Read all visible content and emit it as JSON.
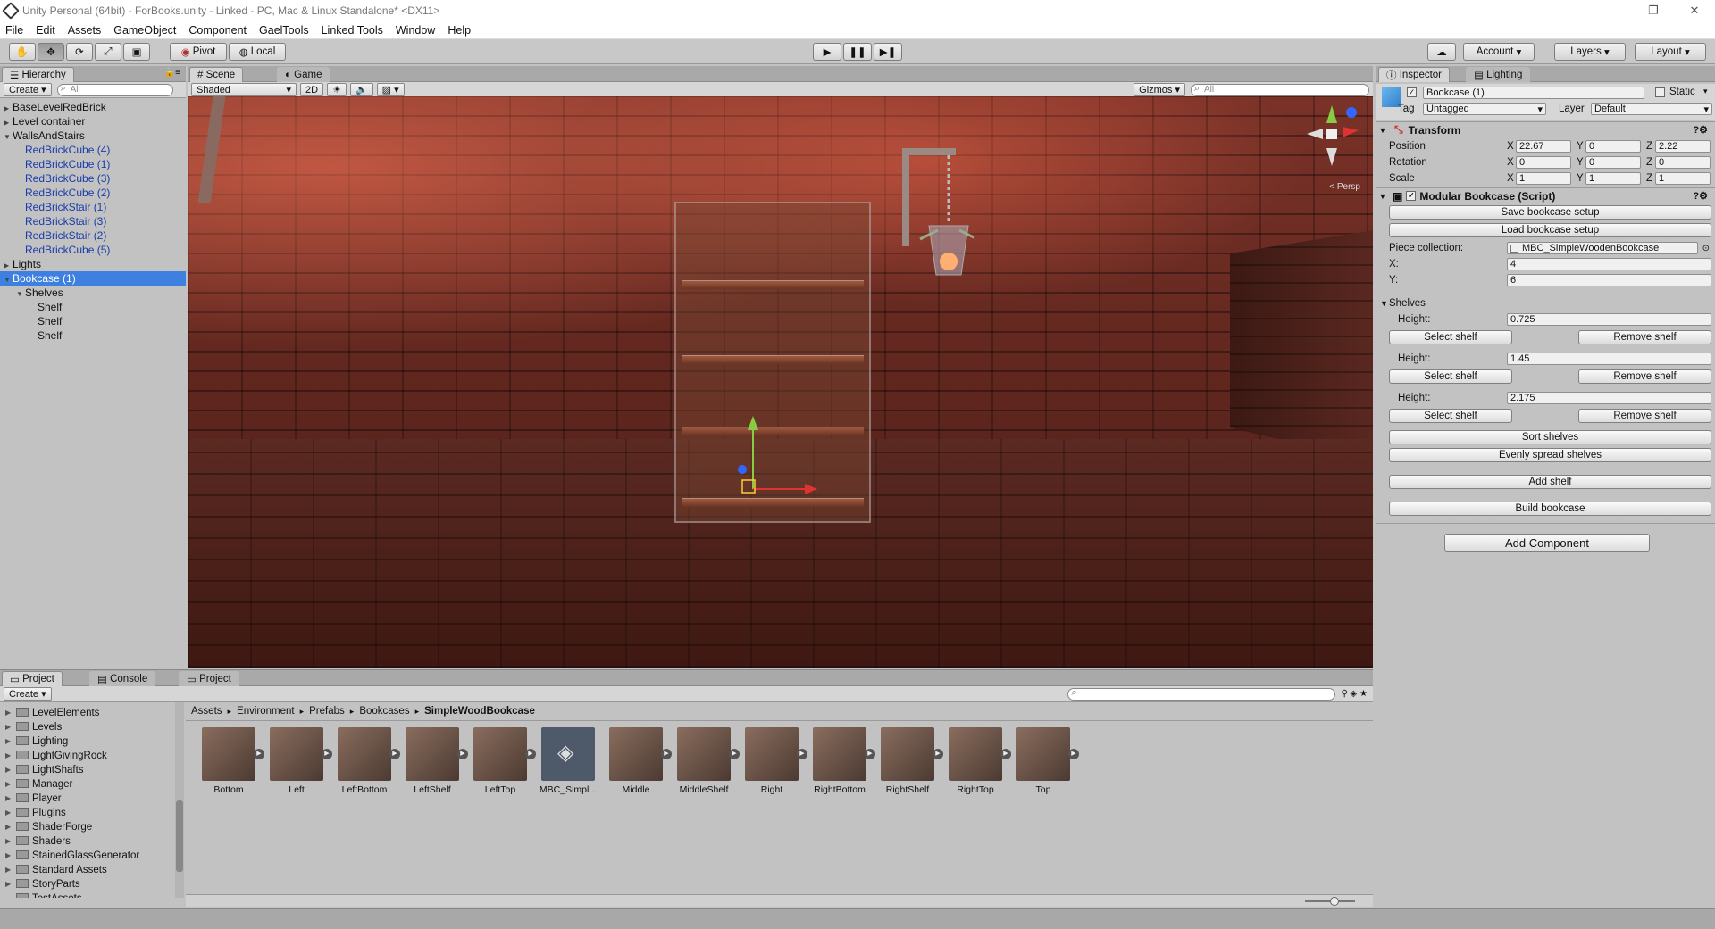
{
  "window": {
    "title": "Unity Personal (64bit) - ForBooks.unity - Linked - PC, Mac & Linux Standalone* <DX11>",
    "minimize": "—",
    "restore": "❐",
    "close": "✕"
  },
  "menu": [
    "File",
    "Edit",
    "Assets",
    "GameObject",
    "Component",
    "GaelTools",
    "Linked Tools",
    "Window",
    "Help"
  ],
  "toolbar": {
    "pivot": "Pivot",
    "local": "Local",
    "account": "Account",
    "layers": "Layers",
    "layout": "Layout"
  },
  "hierarchy": {
    "tab": "Hierarchy",
    "create": "Create",
    "search_placeholder": "All",
    "items": [
      {
        "label": "BaseLevelRedBrick",
        "indent": 0,
        "tri": "▶",
        "style": ""
      },
      {
        "label": "Level container",
        "indent": 0,
        "tri": "▶",
        "style": ""
      },
      {
        "label": "WallsAndStairs",
        "indent": 0,
        "tri": "▼",
        "style": ""
      },
      {
        "label": "RedBrickCube (4)",
        "indent": 1,
        "tri": "",
        "style": "blue"
      },
      {
        "label": "RedBrickCube (1)",
        "indent": 1,
        "tri": "",
        "style": "blue"
      },
      {
        "label": "RedBrickCube (3)",
        "indent": 1,
        "tri": "",
        "style": "blue"
      },
      {
        "label": "RedBrickCube (2)",
        "indent": 1,
        "tri": "",
        "style": "blue"
      },
      {
        "label": "RedBrickStair (1)",
        "indent": 1,
        "tri": "",
        "style": "blue"
      },
      {
        "label": "RedBrickStair (3)",
        "indent": 1,
        "tri": "",
        "style": "blue"
      },
      {
        "label": "RedBrickStair (2)",
        "indent": 1,
        "tri": "",
        "style": "blue"
      },
      {
        "label": "RedBrickCube (5)",
        "indent": 1,
        "tri": "",
        "style": "blue"
      },
      {
        "label": "Lights",
        "indent": 0,
        "tri": "▶",
        "style": ""
      },
      {
        "label": "Bookcase (1)",
        "indent": 0,
        "tri": "▼",
        "style": "sel"
      },
      {
        "label": "Shelves",
        "indent": 1,
        "tri": "▼",
        "style": ""
      },
      {
        "label": "Shelf",
        "indent": 2,
        "tri": "",
        "style": ""
      },
      {
        "label": "Shelf",
        "indent": 2,
        "tri": "",
        "style": ""
      },
      {
        "label": "Shelf",
        "indent": 2,
        "tri": "",
        "style": ""
      }
    ]
  },
  "scene": {
    "tab_scene": "Scene",
    "tab_game": "Game",
    "shading": "Shaded",
    "mode2d": "2D",
    "gizmos": "Gizmos",
    "search_placeholder": "All",
    "persp": "Persp"
  },
  "inspector": {
    "tab": "Inspector",
    "tab_lighting": "Lighting",
    "object_name": "Bookcase (1)",
    "static": "Static",
    "tag_label": "Tag",
    "tag": "Untagged",
    "layer_label": "Layer",
    "layer": "Default",
    "transform": {
      "title": "Transform",
      "rows": [
        {
          "label": "Position",
          "x": "22.67",
          "y": "0",
          "z": "2.22"
        },
        {
          "label": "Rotation",
          "x": "0",
          "y": "0",
          "z": "0"
        },
        {
          "label": "Scale",
          "x": "1",
          "y": "1",
          "z": "1"
        }
      ]
    },
    "script": {
      "title": "Modular Bookcase (Script)",
      "save": "Save bookcase setup",
      "load": "Load bookcase setup",
      "piece_label": "Piece collection:",
      "piece_value": "MBC_SimpleWoodenBookcase",
      "x_label": "X:",
      "x_value": "4",
      "y_label": "Y:",
      "y_value": "6",
      "shelves_label": "Shelves",
      "height_label": "Height:",
      "shelves": [
        {
          "height": "0.725"
        },
        {
          "height": "1.45"
        },
        {
          "height": "2.175"
        }
      ],
      "select_shelf": "Select shelf",
      "remove_shelf": "Remove shelf",
      "sort": "Sort shelves",
      "spread": "Evenly spread shelves",
      "add": "Add shelf",
      "build": "Build bookcase"
    },
    "add_component": "Add Component"
  },
  "project": {
    "tab_project": "Project",
    "tab_console": "Console",
    "tab_project2": "Project",
    "create": "Create",
    "folders": [
      {
        "label": "LevelElements",
        "tri": "▶"
      },
      {
        "label": "Levels",
        "tri": "▶"
      },
      {
        "label": "Lighting",
        "tri": "▶"
      },
      {
        "label": "LightGivingRock",
        "tri": "▶"
      },
      {
        "label": "LightShafts",
        "tri": "▶"
      },
      {
        "label": "Manager",
        "tri": "▶"
      },
      {
        "label": "Player",
        "tri": "▶"
      },
      {
        "label": "Plugins",
        "tri": "▶"
      },
      {
        "label": "ShaderForge",
        "tri": "▶"
      },
      {
        "label": "Shaders",
        "tri": "▶"
      },
      {
        "label": "StainedGlassGenerator",
        "tri": "▶"
      },
      {
        "label": "Standard Assets",
        "tri": "▶"
      },
      {
        "label": "StoryParts",
        "tri": "▶"
      },
      {
        "label": "TestAssets",
        "tri": ""
      }
    ],
    "breadcrumb": [
      "Assets",
      "Environment",
      "Prefabs",
      "Bookcases",
      "SimpleWoodBookcase"
    ],
    "assets": [
      "Bottom",
      "Left",
      "LeftBottom",
      "LeftShelf",
      "LeftTop",
      "MBC_Simpl...",
      "Middle",
      "MiddleShelf",
      "Right",
      "RightBottom",
      "RightShelf",
      "RightTop",
      "Top"
    ]
  }
}
